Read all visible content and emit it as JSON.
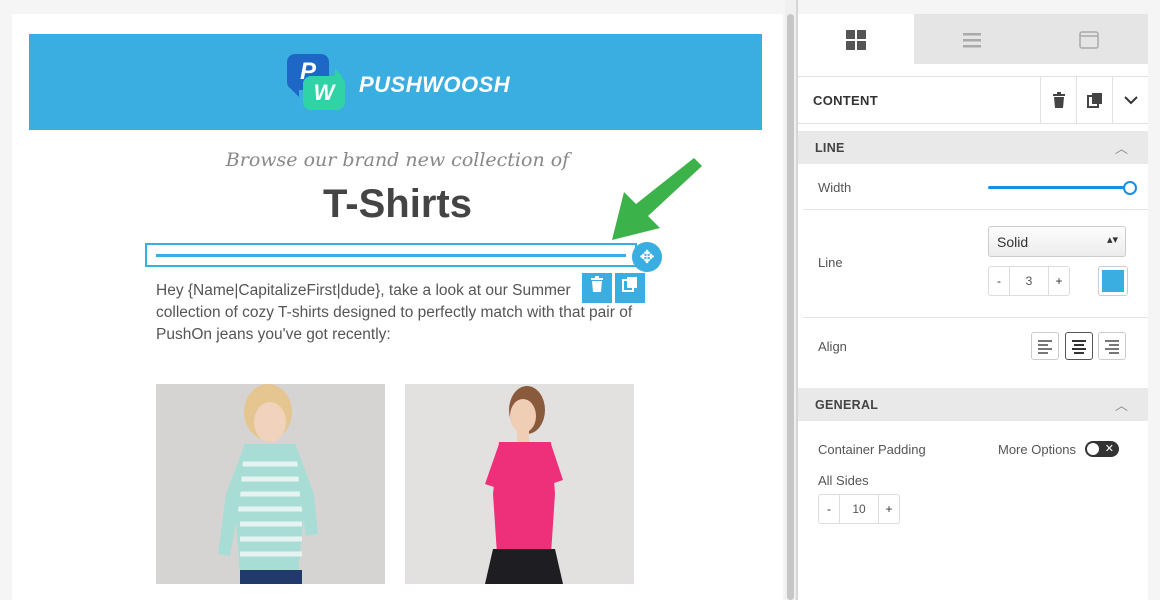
{
  "brand": {
    "name": "PUSHWOOSH",
    "logo_p": "P",
    "logo_w": "W",
    "accent": "#3aaee0"
  },
  "email": {
    "subtitle": "Browse our brand new collection of",
    "headline": "T-Shirts",
    "body": "Hey {Name|CapitalizeFirst|dude}, take a look at our Summer collection of cozy T-shirts designed to perfectly match with that pair of PushOn jeans you've got recently:",
    "line_color": "#3aaee0"
  },
  "panel": {
    "tabs": [
      {
        "icon": "grid-icon",
        "active": true
      },
      {
        "icon": "rows-icon",
        "active": false
      },
      {
        "icon": "window-icon",
        "active": false
      }
    ],
    "content_title": "CONTENT",
    "line_section": {
      "title": "LINE",
      "width_label": "Width",
      "width_value_percent": 100,
      "line_label": "Line",
      "line_style": "Solid",
      "line_thickness": "3",
      "line_color": "#3aaee0",
      "align_label": "Align",
      "align_selected": "center"
    },
    "general_section": {
      "title": "GENERAL",
      "container_padding_label": "Container Padding",
      "more_options_label": "More Options",
      "more_options_enabled": false,
      "all_sides_label": "All Sides",
      "padding_value": "10"
    },
    "stepper_minus": "-",
    "stepper_plus": "+"
  }
}
